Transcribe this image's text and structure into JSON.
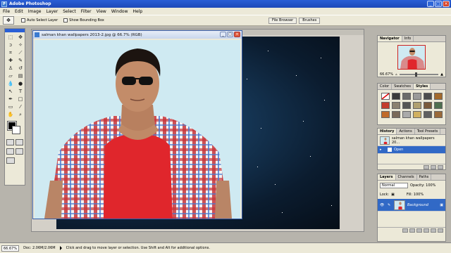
{
  "app": {
    "title": "Adobe Photoshop",
    "icon": "photoshop-app-icon"
  },
  "menu": [
    "File",
    "Edit",
    "Image",
    "Layer",
    "Select",
    "Filter",
    "View",
    "Window",
    "Help"
  ],
  "options": {
    "auto_select": "Auto Select Layer",
    "bounding_box": "Show Bounding Box"
  },
  "wells": [
    "File Browser",
    "Brushes"
  ],
  "document": {
    "title": "salman khan wallpapers 2013-2.jpg @ 66.7% (RGB)"
  },
  "navigator": {
    "tabs": [
      "Navigator",
      "Info"
    ],
    "zoom": "66.67%"
  },
  "styles_panel": {
    "tabs": [
      "Color",
      "Swatches",
      "Styles"
    ]
  },
  "history": {
    "tabs": [
      "History",
      "Actions",
      "Tool Presets"
    ],
    "snapshot": "salman khan wallpapers 20...",
    "state": "Open"
  },
  "layers": {
    "tabs": [
      "Layers",
      "Channels",
      "Paths"
    ],
    "blend": "Normal",
    "opacity_label": "Opacity: 100%",
    "lock_label": "Lock:",
    "fill_label": "Fill: 100%",
    "layer_name": "Background"
  },
  "status": {
    "zoom": "66.67%",
    "doc": "Doc: 2.06M/2.06M",
    "hint": "Click and drag to move layer or selection. Use Shift and Alt for additional options."
  },
  "colors": {
    "title_bar": "#1d49b8",
    "selection": "#3169c6",
    "canvas_bg": "#cfeaf2",
    "shirt_red": "#e0262c"
  }
}
